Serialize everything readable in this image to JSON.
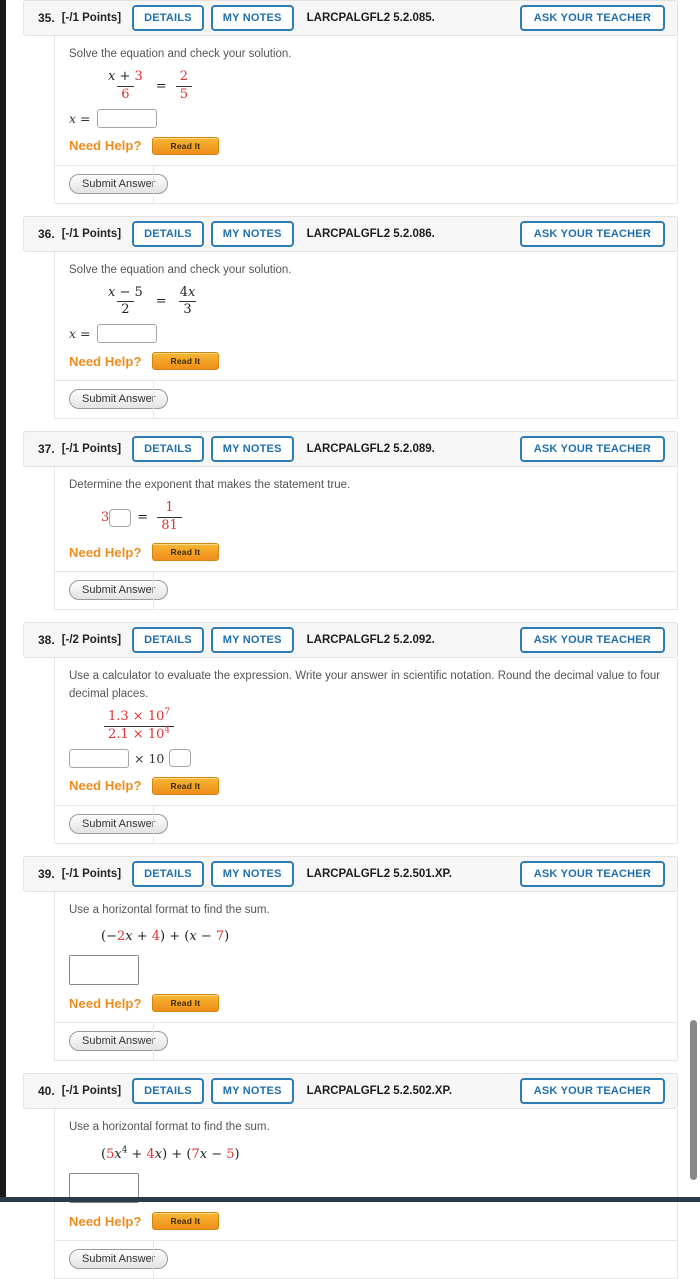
{
  "labels": {
    "details": "DETAILS",
    "my_notes": "MY NOTES",
    "ask_teacher": "ASK YOUR TEACHER",
    "need_help": "Need Help?",
    "read_it": "Read It",
    "submit": "Submit Answer",
    "x_equals": "x ="
  },
  "colors": {
    "accent_blue": "#1f6fae",
    "border_blue": "#2e7cb5",
    "help_orange": "#f08c1e",
    "math_red": "#e03030",
    "header_bg": "#f6f6f6",
    "body_text": "#555555"
  },
  "problems": [
    {
      "number": "35.",
      "points": "[-/1 Points]",
      "code": "LARCPALGFL2 5.2.085.",
      "question": "Solve the equation and check your solution.",
      "math": {
        "kind": "fraction_equation",
        "left_num": "x + 3",
        "left_num_red": "3",
        "left_den": "6",
        "left_den_red": true,
        "right_num": "2",
        "right_den": "5",
        "right_red": true
      },
      "answer": {
        "kind": "x_equals",
        "value": ""
      }
    },
    {
      "number": "36.",
      "points": "[-/1 Points]",
      "code": "LARCPALGFL2 5.2.086.",
      "question": "Solve the equation and check your solution.",
      "math": {
        "kind": "fraction_equation",
        "left_num": "x − 5",
        "left_den": "2",
        "right_num": "4x",
        "right_den": "3",
        "right_red": false
      },
      "answer": {
        "kind": "x_equals",
        "value": ""
      }
    },
    {
      "number": "37.",
      "points": "[-/1 Points]",
      "code": "LARCPALGFL2 5.2.089.",
      "question": "Determine the exponent that makes the statement true.",
      "math": {
        "kind": "exponent_equation",
        "base": "3",
        "exponent_blank": true,
        "right_num": "1",
        "right_den": "81"
      },
      "answer": {
        "kind": "inline_only",
        "value": ""
      }
    },
    {
      "number": "38.",
      "points": "[-/2 Points]",
      "code": "LARCPALGFL2 5.2.092.",
      "question": "Use a calculator to evaluate the expression. Write your answer in scientific notation. Round the decimal value to four decimal places.",
      "math": {
        "kind": "scientific_fraction",
        "num_mantissa": "1.3",
        "num_exp": "7",
        "den_mantissa": "2.1",
        "den_exp": "4",
        "times": "×",
        "base": "10"
      },
      "answer": {
        "kind": "sci_notation",
        "mantissa": "",
        "base": "10",
        "times": "×",
        "exponent": ""
      }
    },
    {
      "number": "39.",
      "points": "[-/1 Points]",
      "code": "LARCPALGFL2 5.2.501.XP.",
      "question": "Use a horizontal format to find the sum.",
      "math": {
        "kind": "polynomial_sum",
        "expression_html": "(−<span class='red'>2</span><span class='ital'>x</span> + <span class='red'>4</span>) + (<span class='ital'>x</span> − <span class='red'>7</span>)",
        "expression_text": "(-2x + 4) + (x - 7)"
      },
      "answer": {
        "kind": "big_box",
        "value": ""
      }
    },
    {
      "number": "40.",
      "points": "[-/1 Points]",
      "code": "LARCPALGFL2 5.2.502.XP.",
      "question": "Use a horizontal format to find the sum.",
      "math": {
        "kind": "polynomial_sum",
        "expression_html": "(<span class='red'>5</span><span class='ital'>x</span><sup>4</sup> + <span class='red'>4</span><span class='ital'>x</span>) + (<span class='red'>7</span><span class='ital'>x</span> − <span class='red'>5</span>)",
        "expression_text": "(5x^4 + 4x) + (7x - 5)"
      },
      "answer": {
        "kind": "big_box",
        "value": ""
      }
    }
  ]
}
